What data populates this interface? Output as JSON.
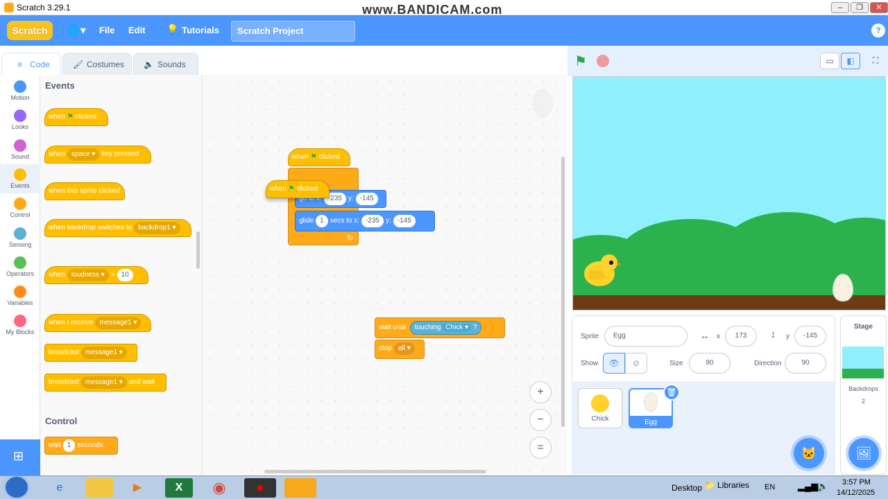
{
  "window": {
    "title": "Scratch 3.29.1",
    "watermark": "www.BANDICAM.com",
    "min": "–",
    "max": "❐",
    "close": "✕"
  },
  "menu": {
    "logo": "Scratch",
    "file": "File",
    "edit": "Edit",
    "tutorials": "Tutorials",
    "project_title": "Scratch Project",
    "help": "?"
  },
  "tabs": {
    "code": "Code",
    "costumes": "Costumes",
    "sounds": "Sounds"
  },
  "categories": [
    {
      "label": "Motion",
      "color": "#4c97ff"
    },
    {
      "label": "Looks",
      "color": "#9966ff"
    },
    {
      "label": "Sound",
      "color": "#cf63cf"
    },
    {
      "label": "Events",
      "color": "#ffbf00"
    },
    {
      "label": "Control",
      "color": "#ffab19"
    },
    {
      "label": "Sensing",
      "color": "#5cb1d6"
    },
    {
      "label": "Operators",
      "color": "#59c059"
    },
    {
      "label": "Variables",
      "color": "#ff8c1a"
    },
    {
      "label": "My Blocks",
      "color": "#ff6680"
    }
  ],
  "palette": {
    "events_heading": "Events",
    "when": "when",
    "clicked": "clicked",
    "key_pressed": "key pressed",
    "space": "space",
    "when_sprite_clicked": "when this sprite clicked",
    "when_backdrop": "when backdrop switches to",
    "backdrop1": "backdrop1",
    "loudness": "loudness",
    "gt": ">",
    "ten": "10",
    "when_receive": "when I receive",
    "message1": "message1",
    "broadcast": "broadcast",
    "and_wait": "and wait",
    "control_heading": "Control",
    "wait": "wait",
    "one": "1",
    "seconds": "seconds"
  },
  "script": {
    "when": "when",
    "clicked": "clicked",
    "goto": "go to x:",
    "x": "-235",
    "y_label": "y:",
    "y": "-145",
    "glide": "glide",
    "glide_secs": "1",
    "secs_to": "secs to x:",
    "gx": "-235",
    "gy": "-145",
    "wait_until": "wait until",
    "touching": "touching",
    "chick": "Chick",
    "q": "?",
    "stop": "stop",
    "all": "all"
  },
  "zoom": {
    "in": "+",
    "out": "−",
    "reset": "="
  },
  "sprite": {
    "label": "Sprite",
    "name": "Egg",
    "x_label": "x",
    "x": "173",
    "y_label": "y",
    "y": "-145",
    "show": "Show",
    "size_label": "Size",
    "size": "80",
    "direction_label": "Direction",
    "direction": "90"
  },
  "sprites": [
    {
      "name": "Chick"
    },
    {
      "name": "Egg"
    }
  ],
  "stage": {
    "label": "Stage",
    "backdrops_label": "Backdrops",
    "backdrops": "2"
  },
  "taskbar": {
    "desktop": "Desktop",
    "libraries": "Libraries",
    "lang": "EN",
    "time": "3:57 PM",
    "date": "14/12/2025"
  }
}
